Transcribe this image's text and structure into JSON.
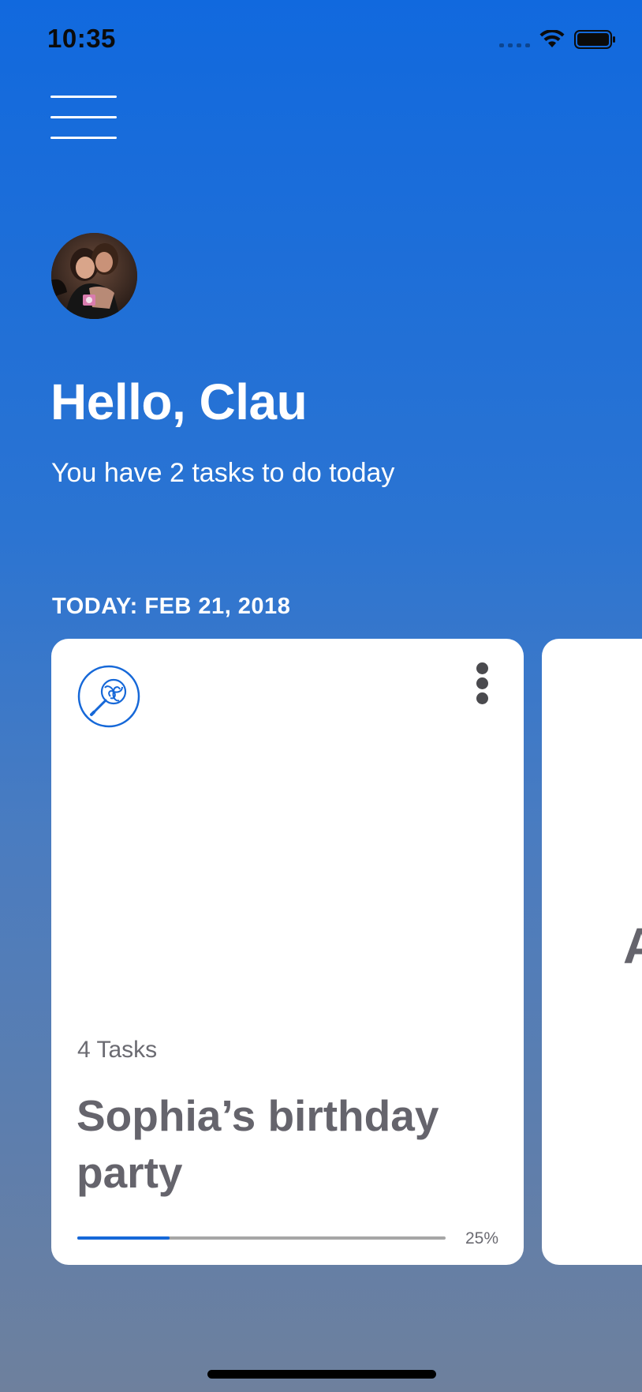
{
  "status_bar": {
    "time": "10:35"
  },
  "header": {
    "menu_icon": "hamburger-menu-icon",
    "avatar": "user-avatar-photo"
  },
  "greeting": {
    "title": "Hello, Clau",
    "subtitle": "You have 2 tasks to do today"
  },
  "date_label": "TODAY: FEB 21, 2018",
  "cards": [
    {
      "icon": "lollipop-icon",
      "count": "4 Tasks",
      "title": "Sophia’s birthday party",
      "progress_label": "25%",
      "progress": 0.25
    },
    {
      "title": "A"
    }
  ],
  "colors": {
    "accent": "#1668d8",
    "card_text": "#65646c",
    "gradient_top": "#1169de",
    "gradient_bottom": "#6e809d"
  }
}
